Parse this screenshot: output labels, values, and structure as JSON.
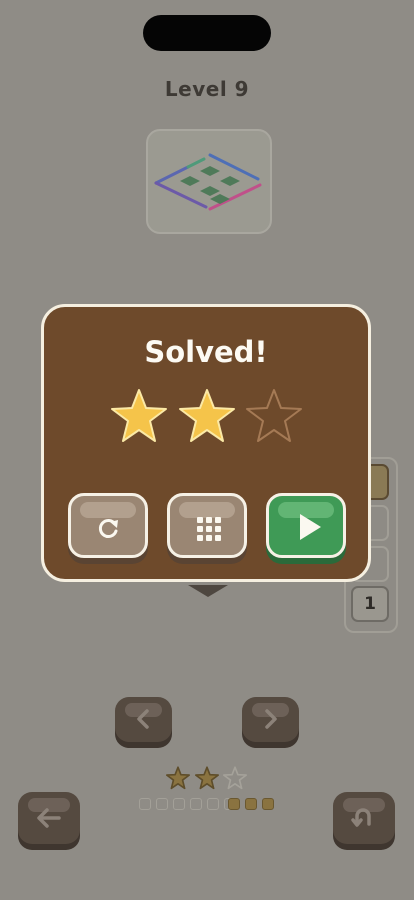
{
  "header": {
    "level_title": "Level 9"
  },
  "side_panel": {
    "number_label": "1"
  },
  "solved_dialog": {
    "title": "Solved!",
    "stars": {
      "earned": 2,
      "total": 3
    },
    "buttons": {
      "restart_icon": "refresh-icon",
      "level_select_icon": "grid-icon",
      "next_icon": "play-icon"
    }
  },
  "navigation": {
    "prev_icon": "chevron-left-icon",
    "next_icon": "chevron-right-icon",
    "back_icon": "arrow-left-icon",
    "undo_icon": "undo-icon"
  },
  "progress": {
    "stars": {
      "earned": 2,
      "total": 3
    },
    "levels_total": 9,
    "levels_completed_style": [
      false,
      false,
      false,
      false,
      false,
      false,
      true,
      true,
      true
    ]
  },
  "colors": {
    "background": "#8f8c86",
    "dialog": "#6e4a2b",
    "star": "#f5c44a",
    "play_button": "#3f9a56",
    "restart_button": "#9a8673"
  }
}
